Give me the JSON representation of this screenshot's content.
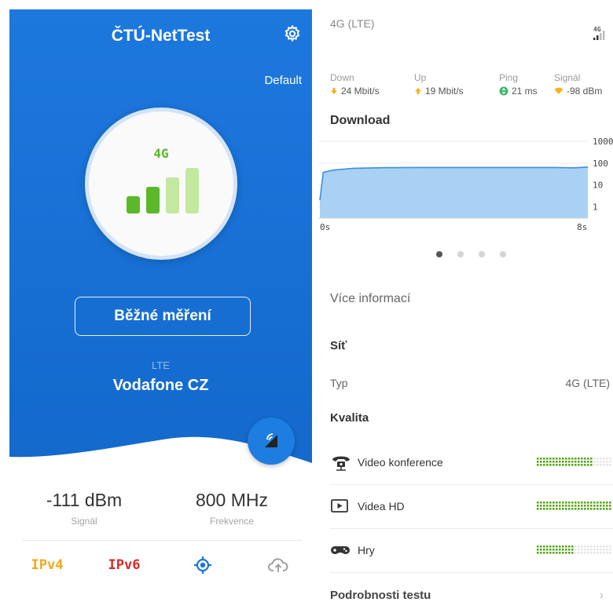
{
  "left": {
    "app_title": "ČTÚ-NetTest",
    "profile": "Default",
    "tech_badge": "4G",
    "main_button": "Běžné měření",
    "network_type": "LTE",
    "operator": "Vodafone CZ",
    "signal_value": "-111 dBm",
    "signal_label": "Signál",
    "frequency_value": "800 MHz",
    "frequency_label": "Frekvence",
    "signal_level": 2,
    "signal_level_max": 4,
    "nav": {
      "ipv4": "IPv4",
      "ipv6": "IPv6"
    },
    "colors": {
      "primary": "#1a75db",
      "green": "#5cb82a",
      "green_light": "#c3e8a0",
      "ipv4": "#f0a81c",
      "ipv6": "#d9292a"
    }
  },
  "right": {
    "tech_head": "4G (LTE)",
    "mini_badge": "4G",
    "metrics": [
      {
        "label": "Down",
        "value": "24 Mbit/s",
        "icon": "arrow-down-icon"
      },
      {
        "label": "Up",
        "value": "19 Mbit/s",
        "icon": "arrow-up-icon"
      },
      {
        "label": "Ping",
        "value": "21 ms",
        "icon": "ping-icon"
      },
      {
        "label": "Signál",
        "value": "-98 dBm",
        "icon": "wifi-icon"
      }
    ],
    "download_title": "Download",
    "chart_data": {
      "type": "area",
      "title": "Download",
      "x_unit": "s",
      "x_range": [
        0,
        8
      ],
      "x_ticks": [
        "0s",
        "8s"
      ],
      "y_scale": "log",
      "y_ticks": [
        "1000",
        "100",
        "10",
        "1"
      ],
      "y_range": [
        0.3,
        1000
      ],
      "points": [
        [
          0,
          2
        ],
        [
          0.1,
          38
        ],
        [
          0.4,
          48
        ],
        [
          1,
          58
        ],
        [
          2,
          62
        ],
        [
          3,
          63
        ],
        [
          4,
          63
        ],
        [
          5,
          63
        ],
        [
          6,
          63
        ],
        [
          7,
          63
        ],
        [
          7.6,
          61
        ],
        [
          8,
          66
        ]
      ]
    },
    "pager": {
      "count": 4,
      "active": 0
    },
    "more_info": "Více informací",
    "section_network": "Síť",
    "type_label": "Typ",
    "type_value": "4G (LTE)",
    "section_quality": "Kvalita",
    "quality": [
      {
        "label": "Video konference",
        "icon": "video-conference-icon",
        "level": 0.75
      },
      {
        "label": "Videa HD",
        "icon": "video-hd-icon",
        "level": 1.0
      },
      {
        "label": "Hry",
        "icon": "gamepad-icon",
        "level": 0.5
      }
    ],
    "details": "Podrobnosti testu"
  }
}
